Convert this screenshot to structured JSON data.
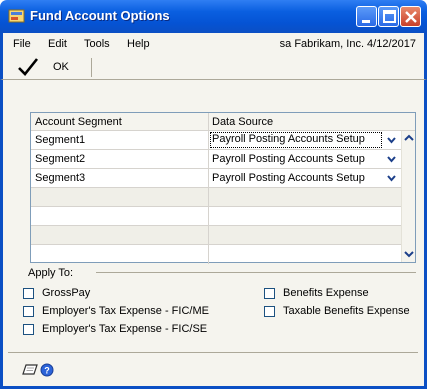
{
  "window": {
    "title": "Fund Account Options"
  },
  "menu": {
    "items": [
      "File",
      "Edit",
      "Tools",
      "Help"
    ],
    "status": "sa  Fabrikam, Inc.  4/12/2017"
  },
  "toolbar": {
    "ok_label": "OK"
  },
  "grid": {
    "headers": [
      "Account Segment",
      "Data Source"
    ],
    "rows": [
      {
        "segment": "Segment1",
        "source": "Payroll Posting Accounts Setup"
      },
      {
        "segment": "Segment2",
        "source": "Payroll Posting Accounts Setup"
      },
      {
        "segment": "Segment3",
        "source": "Payroll Posting Accounts Setup"
      }
    ]
  },
  "apply_to": {
    "label": "Apply To:",
    "options": [
      {
        "label": "GrossPay",
        "checked": false
      },
      {
        "label": "Employer's Tax Expense - FIC/ME",
        "checked": false
      },
      {
        "label": "Employer's Tax Expense - FIC/SE",
        "checked": false
      },
      {
        "label": "Benefits Expense",
        "checked": false
      },
      {
        "label": "Taxable Benefits Expense",
        "checked": false
      }
    ]
  },
  "icons": [
    "app-icon",
    "minimize-icon",
    "maximize-icon",
    "close-icon",
    "checkmark-icon",
    "chevron-down-icon",
    "scroll-up-icon",
    "scroll-down-icon",
    "note-icon",
    "help-icon"
  ]
}
